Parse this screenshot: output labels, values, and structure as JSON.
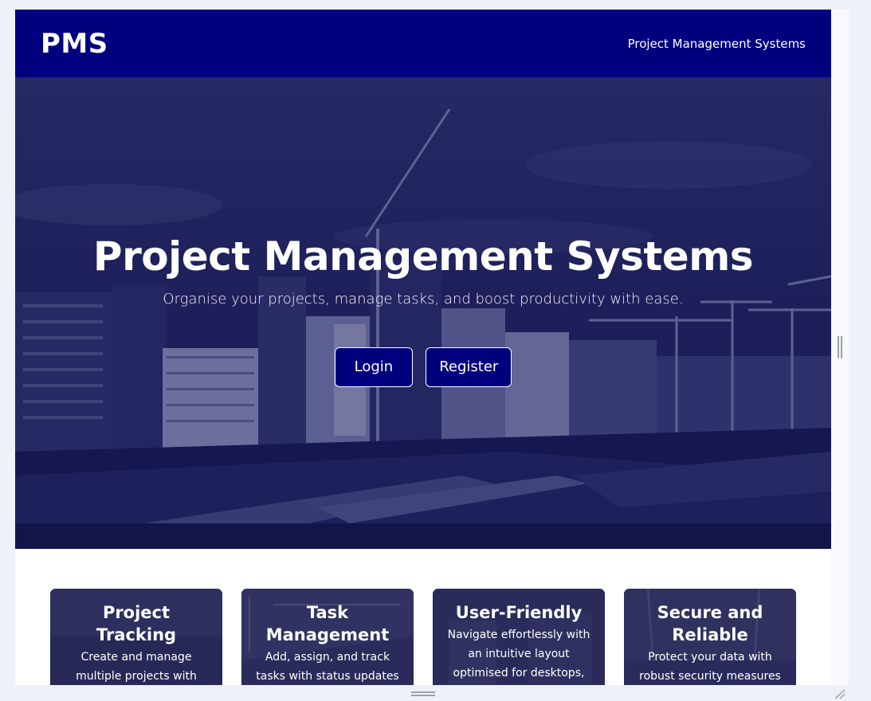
{
  "navbar": {
    "brand": "PMS",
    "link": "Project Management Systems"
  },
  "hero": {
    "title": "Project Management Systems",
    "subtitle": "Organise your projects, manage tasks, and boost productivity with ease.",
    "login_label": "Login",
    "register_label": "Register"
  },
  "features": [
    {
      "title": "Project Tracking",
      "text": "Create and manage multiple projects with timelines and status"
    },
    {
      "title": "Task Management",
      "text": "Add, assign, and track tasks with status updates"
    },
    {
      "title": "User-Friendly",
      "text": "Navigate effortlessly with an intuitive layout optimised for desktops,"
    },
    {
      "title": "Secure and Reliable",
      "text": "Protect your data with robust security measures"
    }
  ],
  "colors": {
    "navbar": "#00007f",
    "button": "#00007f",
    "overlay": "#10125a"
  }
}
